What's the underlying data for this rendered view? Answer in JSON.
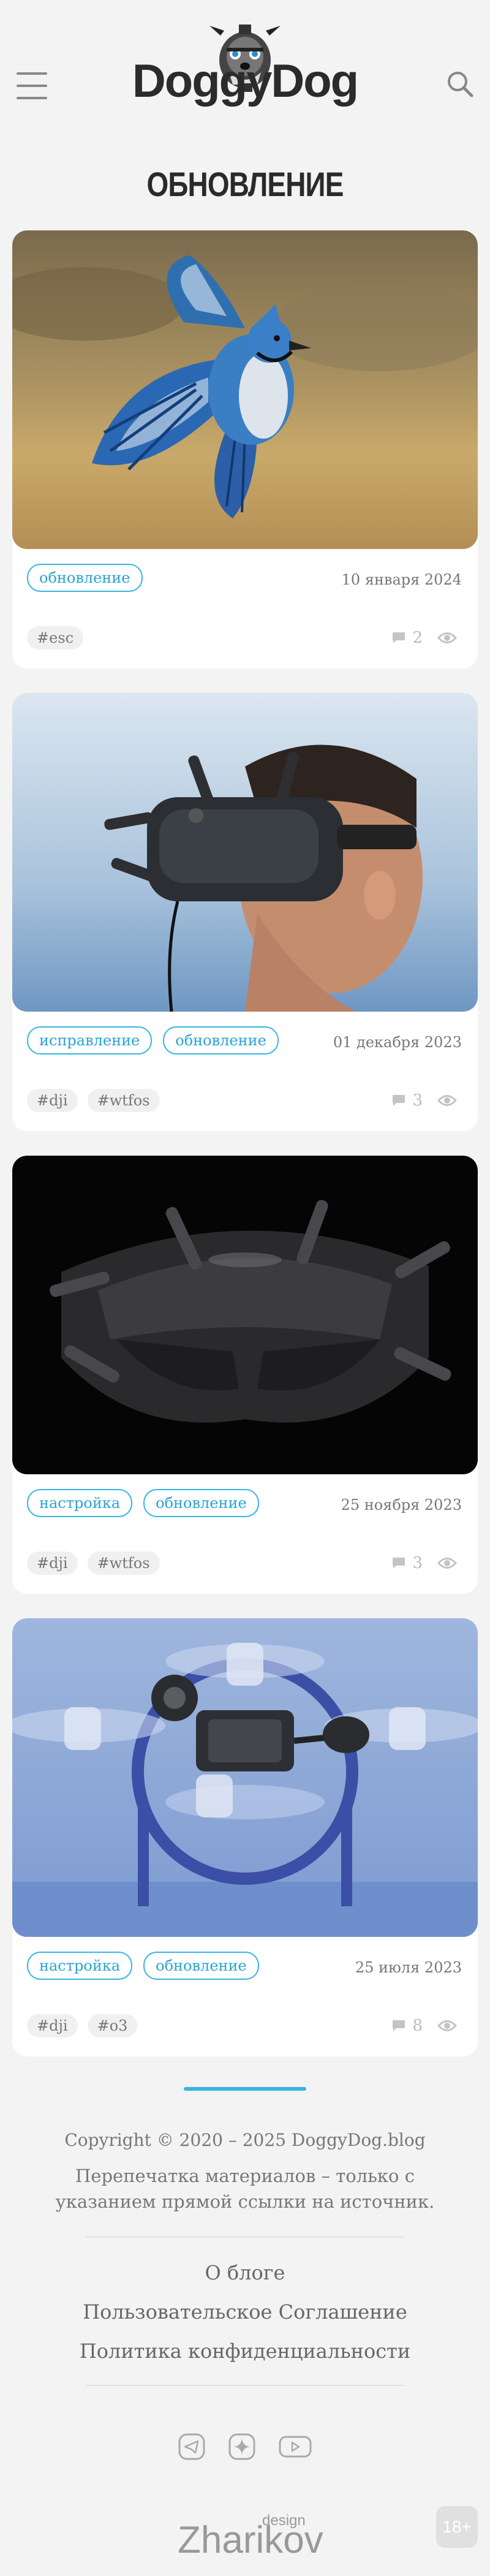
{
  "header": {
    "logo_text": "DoggyDog",
    "title": "ОБНОВЛЕНИЕ"
  },
  "posts": [
    {
      "categories": [
        "обновление"
      ],
      "date": "10 января 2024",
      "hashtags": [
        "#esc"
      ],
      "comments": "2",
      "image_subject": "blue jay in flight"
    },
    {
      "categories": [
        "исправление",
        "обновление"
      ],
      "date": "01 декабря 2023",
      "hashtags": [
        "#dji",
        "#wtfos"
      ],
      "comments": "3",
      "image_subject": "man wearing FPV goggles"
    },
    {
      "categories": [
        "настройка",
        "обновление"
      ],
      "date": "25 ноября 2023",
      "hashtags": [
        "#dji",
        "#wtfos"
      ],
      "comments": "3",
      "image_subject": "FPV goggles on black background"
    },
    {
      "categories": [
        "настройка",
        "обновление"
      ],
      "date": "25 июля 2023",
      "hashtags": [
        "#dji",
        "#o3"
      ],
      "comments": "8",
      "image_subject": "FPV drone with camera unit"
    }
  ],
  "footer": {
    "copyright": "Copyright © 2020 – 2025 DoggyDog.blog",
    "reprint": "Перепечатка материалов – только с указанием прямой ссылки на источник.",
    "links": [
      "О блоге",
      "Пользовательское Соглашение",
      "Политика конфиденциальности"
    ],
    "socials": [
      "telegram-icon",
      "zen-icon",
      "youtube-icon"
    ],
    "design_word": "design",
    "design_name": "Zharikov",
    "age": "18+"
  },
  "colors": {
    "accent": "#36b5e3",
    "background": "#f3f3f3",
    "card": "#ffffff"
  }
}
